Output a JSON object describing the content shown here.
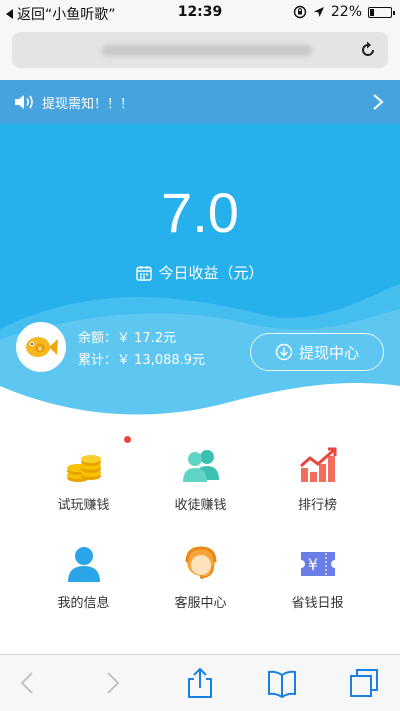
{
  "status_bar": {
    "back_label": "返回“小鱼听歌”",
    "time": "12:39",
    "battery": "22%",
    "battery_level": 0.22
  },
  "notice": {
    "text": "提现需知！！！"
  },
  "earnings": {
    "today_value": "7.0",
    "today_label": "今日收益（元）",
    "balance_label": "余额：",
    "balance_value": "￥ 17.2元",
    "total_label": "累计：",
    "total_value": "￥ 13,088.9元",
    "withdraw_button": "提现中心"
  },
  "menu": {
    "items": [
      {
        "label": "试玩赚钱",
        "icon": "gold-coins-icon",
        "badge": true
      },
      {
        "label": "收徒赚钱",
        "icon": "people-icon",
        "badge": false
      },
      {
        "label": "排行榜",
        "icon": "trend-chart-icon",
        "badge": false
      },
      {
        "label": "我的信息",
        "icon": "person-icon",
        "badge": false
      },
      {
        "label": "客服中心",
        "icon": "customer-service-icon",
        "badge": false
      },
      {
        "label": "省钱日报",
        "icon": "yuan-ticket-icon",
        "badge": false
      }
    ]
  },
  "colors": {
    "hero_blue": "#26b1ec",
    "notice_blue": "#46a3dd",
    "badge_red": "#e8453c"
  }
}
